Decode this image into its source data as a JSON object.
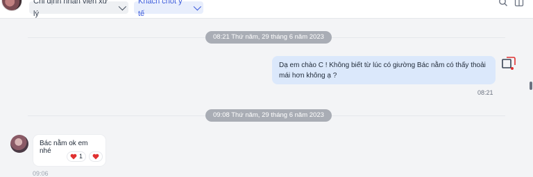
{
  "header": {
    "assign_label": "Chỉ định nhân viên xử lý",
    "tag_label": "Khách chốt y tế"
  },
  "messages": [
    {
      "date_separator": "08:21 Thứ năm, 29 tháng 6 năm 2023"
    },
    {
      "direction": "outgoing",
      "text": "Dạ em chào C ! Không biết từ lúc có giường Bác nằm có thấy thoải mái hơn không ạ ?",
      "time": "08:21"
    },
    {
      "date_separator": "09:08 Thứ năm, 29 tháng 6 năm 2023"
    },
    {
      "direction": "incoming",
      "text": "Bác nằm ok em nhé",
      "reactions": [
        {
          "icon": "heart-icon",
          "count": "1"
        },
        {
          "icon": "heart-icon",
          "count": ""
        }
      ],
      "time": "09:06"
    }
  ],
  "colors": {
    "accent": "#3b5bdb",
    "outgoing_bubble": "#dbe8fb",
    "date_chip": "#a9adb5",
    "heart": "#e03131"
  }
}
